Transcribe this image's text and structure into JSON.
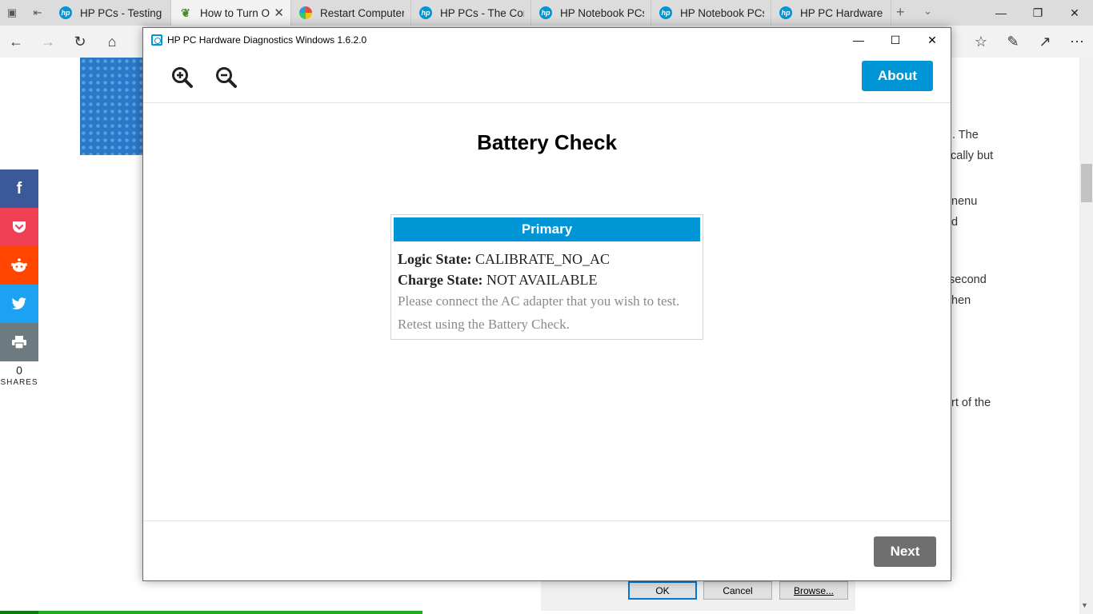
{
  "browser": {
    "tabs": [
      {
        "title": "HP PCs - Testing fc",
        "icon": "hp-icon"
      },
      {
        "title": "How to Turn O",
        "icon": "leaf-icon",
        "active": true
      },
      {
        "title": "Restart Computer i",
        "icon": "multicolor-icon"
      },
      {
        "title": "HP PCs - The Com|",
        "icon": "hp-icon"
      },
      {
        "title": "HP Notebook PCs",
        "icon": "hp-icon"
      },
      {
        "title": "HP Notebook PCs",
        "icon": "hp-icon"
      },
      {
        "title": "HP PC Hardware D",
        "icon": "hp-icon"
      }
    ]
  },
  "webpage": {
    "share_count": "0",
    "share_label": "SHARES",
    "text_fragments": [
      ". The",
      "cally but",
      "nenu",
      "d",
      "second",
      "hen",
      "rt of the"
    ],
    "dialog_buttons": {
      "ok": "OK",
      "cancel": "Cancel",
      "browse": "Browse..."
    },
    "colors": {
      "facebook": "#3b5998",
      "pocket": "#ef4056",
      "reddit": "#ff4500",
      "twitter": "#1da1f2",
      "print": "#6d7a7f"
    }
  },
  "app": {
    "window_title": "HP PC Hardware Diagnostics Windows 1.6.2.0",
    "about_label": "About",
    "heading": "Battery Check",
    "card": {
      "header": "Primary",
      "logic_label": "Logic State:",
      "logic_value": "CALIBRATE_NO_AC",
      "charge_label": "Charge State:",
      "charge_value": "NOT AVAILABLE",
      "note_1": "Please connect the AC adapter that you wish to test.",
      "note_2": "Retest using the Battery Check."
    },
    "next_label": "Next",
    "colors": {
      "accent": "#0096d6",
      "next_button": "#6f6f6f"
    }
  }
}
